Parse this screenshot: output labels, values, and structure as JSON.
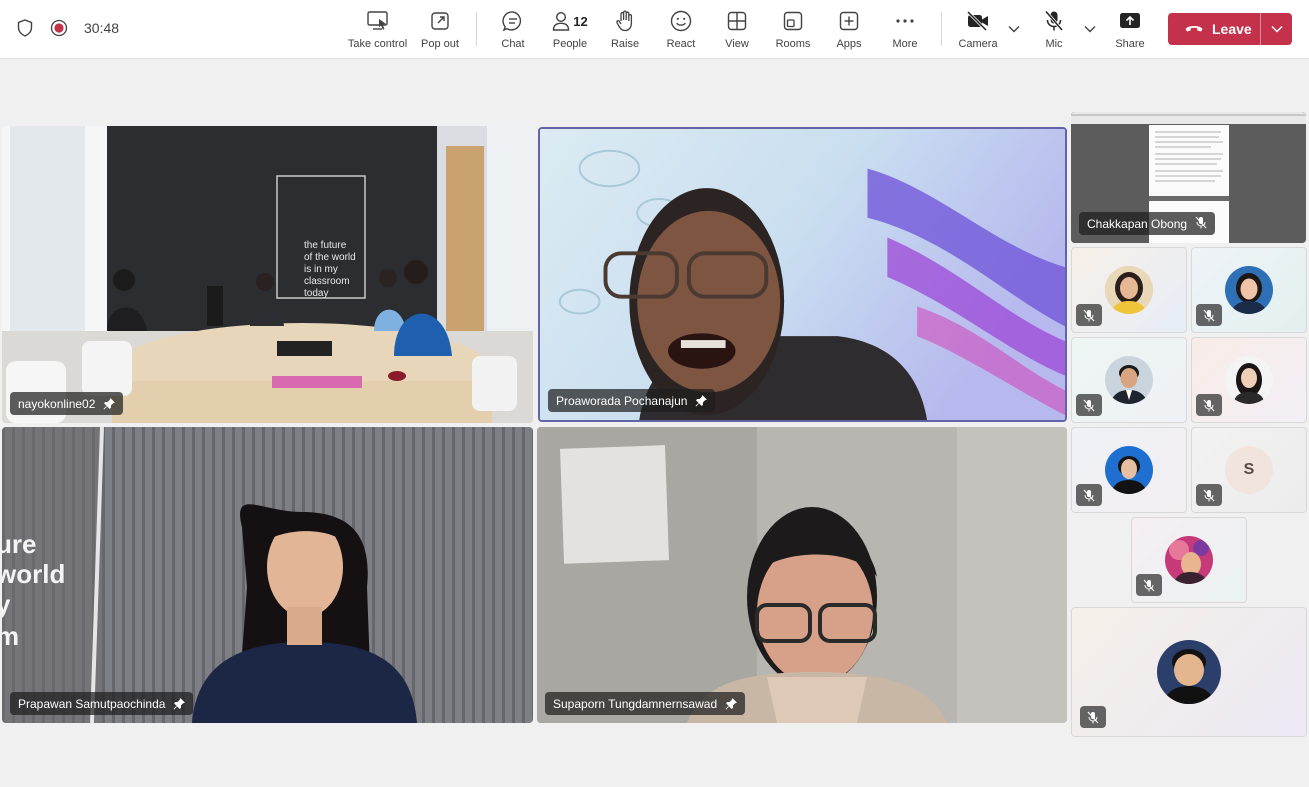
{
  "meeting": {
    "timer": "30:48",
    "people_count": "12"
  },
  "toolbar": {
    "take_control": "Take control",
    "pop_out": "Pop out",
    "chat": "Chat",
    "people": "People",
    "raise": "Raise",
    "react": "React",
    "view": "View",
    "rooms": "Rooms",
    "apps": "Apps",
    "more": "More",
    "camera": "Camera",
    "mic": "Mic",
    "share": "Share",
    "leave": "Leave"
  },
  "main_tiles": [
    {
      "name": "nayokonline02",
      "wall_text": [
        "the future",
        "of the world",
        "is in my",
        "classroom",
        "today"
      ]
    },
    {
      "name": "Proaworada Pochanajun"
    },
    {
      "name": "Prapawan Samutpaochinda",
      "wall_text": [
        "ure",
        "world",
        "y",
        "m"
      ]
    },
    {
      "name": "Supaporn Tungdamnernsawad"
    }
  ],
  "side_tiles": {
    "screen_share_name": "Chakkapan Obong",
    "participant_initial": "S"
  },
  "colors": {
    "leave": "#c4314b",
    "active_speaker_border": "#6264a7",
    "toolbar_bg": "#ffffff",
    "stage_bg": "#f0f0f0"
  }
}
